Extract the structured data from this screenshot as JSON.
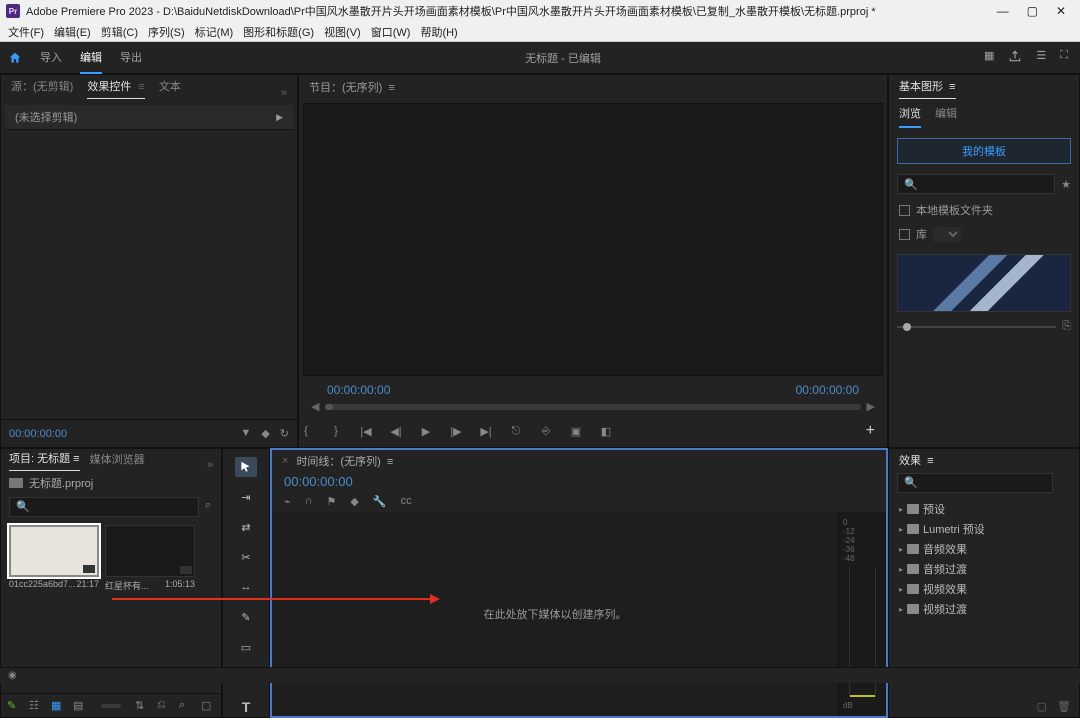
{
  "titlebar": {
    "app_badge": "Pr",
    "title": "Adobe Premiere Pro 2023 - D:\\BaiduNetdiskDownload\\Pr中国风水墨散开片头开场画面素材模板\\Pr中国风水墨散开片头开场画面素材模板\\已复制_水墨散开模板\\无标题.prproj *"
  },
  "menu": [
    "文件(F)",
    "编辑(E)",
    "剪辑(C)",
    "序列(S)",
    "标记(M)",
    "图形和标题(G)",
    "视图(V)",
    "窗口(W)",
    "帮助(H)"
  ],
  "topbar": {
    "tabs": [
      "导入",
      "编辑",
      "导出"
    ],
    "active": 1,
    "center": "无标题 - 已编辑"
  },
  "source": {
    "tabs": [
      "源：(无剪辑)",
      "效果控件",
      "文本"
    ],
    "active": 1,
    "no_select": "(未选择剪辑)",
    "tc": "00:00:00:00"
  },
  "program": {
    "tab": "节目：(无序列)",
    "tc_left": "00:00:00:00",
    "tc_right": "00:00:00:00"
  },
  "egp": {
    "title": "基本图形",
    "tabs": [
      "浏览",
      "编辑"
    ],
    "active": 0,
    "my_templates": "我的模板",
    "search_ph": "",
    "local_folder": "本地模板文件夹",
    "library": "库"
  },
  "effects": {
    "title": "效果",
    "items": [
      "预设",
      "Lumetri 预设",
      "音频效果",
      "音频过渡",
      "视频效果",
      "视频过渡"
    ]
  },
  "project": {
    "tabs": [
      "项目: 无标题",
      "媒体浏览器"
    ],
    "active": 0,
    "file": "无标题.prproj",
    "clips": [
      {
        "name": "01cc225a6bd7...",
        "dur": "21:17"
      },
      {
        "name": "红星杯有...",
        "dur": "1:05:13"
      }
    ]
  },
  "timeline": {
    "tab": "时间线：(无序列)",
    "tc": "00:00:00:00",
    "drop": "在此处放下媒体以创建序列。",
    "dblabels": [
      "0",
      "-12",
      "-24",
      "-36",
      "-48",
      "dB"
    ]
  }
}
